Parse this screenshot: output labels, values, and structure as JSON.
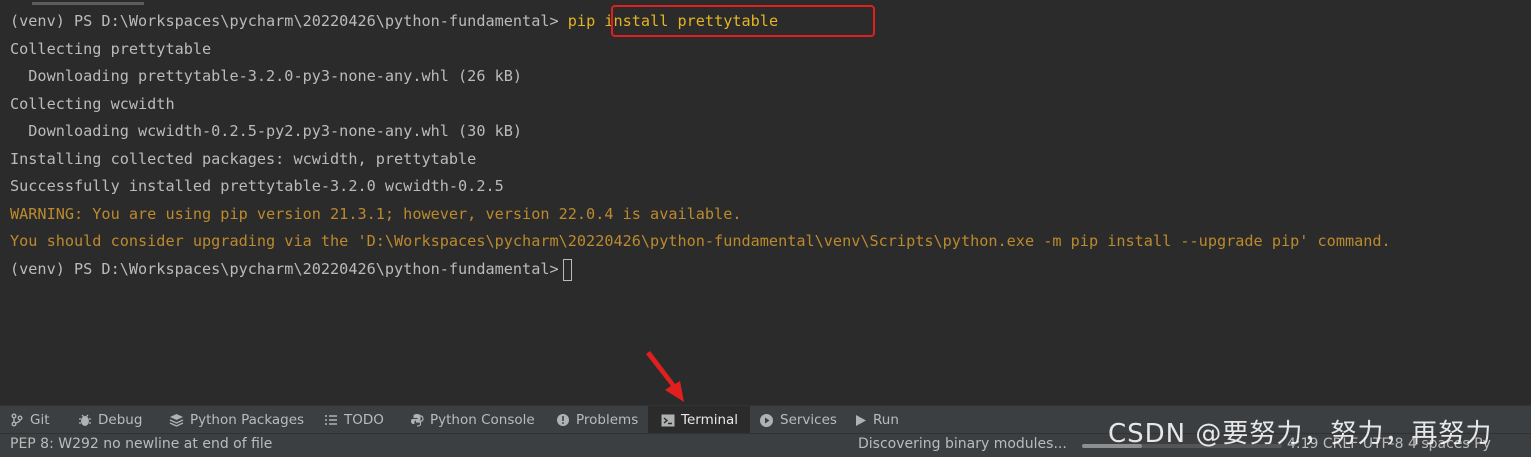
{
  "terminal": {
    "prompt1": "(venv) PS D:\\Workspaces\\pycharm\\20220426\\python-fundamental>",
    "command": "pip install prettytable",
    "lines": [
      "Collecting prettytable",
      "  Downloading prettytable-3.2.0-py3-none-any.whl (26 kB)",
      "Collecting wcwidth",
      "  Downloading wcwidth-0.2.5-py2.py3-none-any.whl (30 kB)",
      "Installing collected packages: wcwidth, prettytable",
      "Successfully installed prettytable-3.2.0 wcwidth-0.2.5"
    ],
    "warnings": [
      "WARNING: You are using pip version 21.3.1; however, version 22.0.4 is available.",
      "You should consider upgrading via the 'D:\\Workspaces\\pycharm\\20220426\\python-fundamental\\venv\\Scripts\\python.exe -m pip install --upgrade pip' command."
    ],
    "prompt2": "(venv) PS D:\\Workspaces\\pycharm\\20220426\\python-fundamental>"
  },
  "tool_windows": [
    {
      "label": "Git",
      "icon": "git-branch-icon"
    },
    {
      "label": "Debug",
      "icon": "bug-icon"
    },
    {
      "label": "Python Packages",
      "icon": "packages-icon"
    },
    {
      "label": "TODO",
      "icon": "list-icon"
    },
    {
      "label": "Python Console",
      "icon": "python-icon"
    },
    {
      "label": "Problems",
      "icon": "info-icon"
    },
    {
      "label": "Terminal",
      "icon": "terminal-icon",
      "active": true
    },
    {
      "label": "Services",
      "icon": "services-icon"
    },
    {
      "label": "Run",
      "icon": "play-icon"
    }
  ],
  "status": {
    "left": "PEP 8: W292 no newline at end of file",
    "progress_text": "Discovering binary modules...",
    "progress_fraction": 0.3,
    "right": "4:19  CRLF  UTF-8  4 spaces  Py"
  },
  "watermark": "CSDN @要努力，努力，再努力",
  "colors": {
    "background": "#2b2b2b",
    "text": "#bbbbbb",
    "warning": "#bb8a2d",
    "command": "#e6b422",
    "highlight_border": "#e0201f",
    "arrow": "#e0201f",
    "toolbar": "#3c3f41"
  }
}
